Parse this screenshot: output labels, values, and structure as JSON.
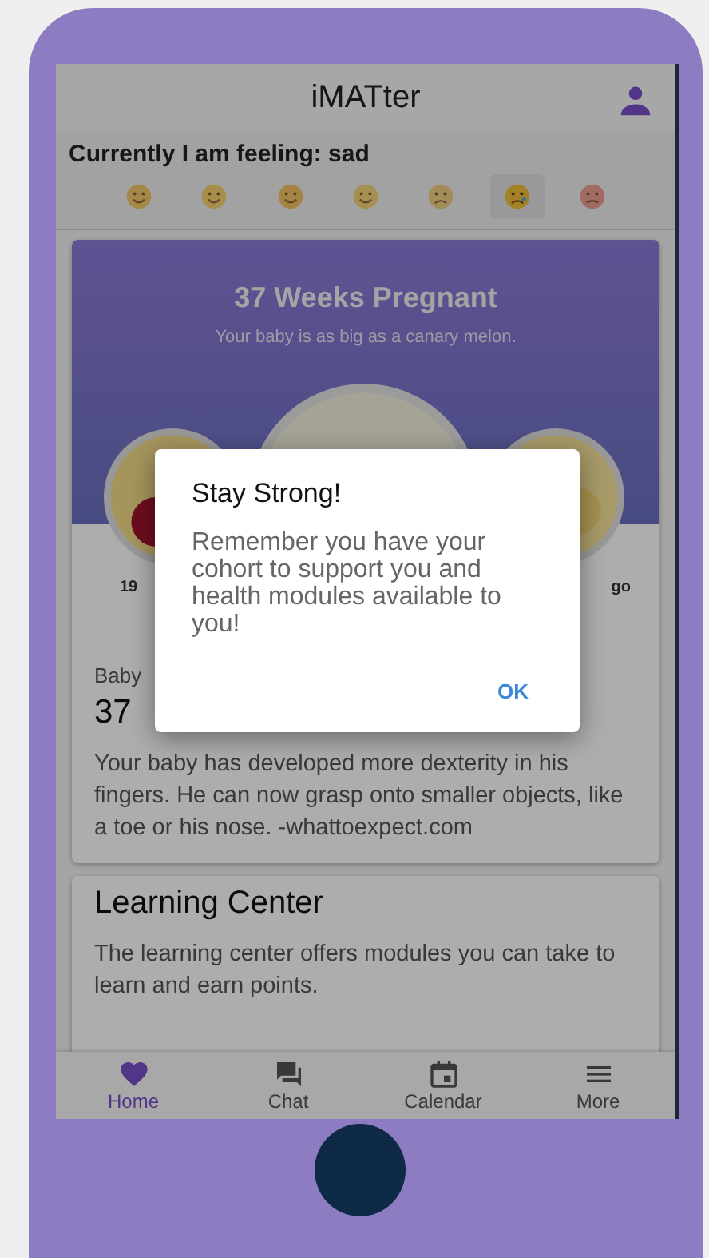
{
  "app_bar": {
    "title": "iMATter"
  },
  "mood_bar": {
    "label": "Currently I am feeling: sad",
    "moods": [
      {
        "kind": "hug",
        "selected": false
      },
      {
        "kind": "happy",
        "selected": false
      },
      {
        "kind": "love",
        "selected": false
      },
      {
        "kind": "neutral",
        "selected": false
      },
      {
        "kind": "tired",
        "selected": false
      },
      {
        "kind": "sad",
        "selected": true
      },
      {
        "kind": "angry",
        "selected": false
      }
    ]
  },
  "pregnancy_card": {
    "title": "37 Weeks Pregnant",
    "subtitle": "Your baby is as big as a canary melon.",
    "left_caption": "19",
    "right_caption": "go",
    "eyebrow": "Baby",
    "heading": "37",
    "body": "Your baby has developed more dexterity in his fingers. He can now grasp onto smaller objects, like a toe or his nose. -whattoexpect.com"
  },
  "learning_card": {
    "title": "Learning Center",
    "body": "The learning center offers modules you can take to learn and earn points."
  },
  "nav": [
    {
      "kind": "home",
      "label": "Home",
      "selected": true
    },
    {
      "kind": "chat",
      "label": "Chat",
      "selected": false
    },
    {
      "kind": "calendar",
      "label": "Calendar",
      "selected": false
    },
    {
      "kind": "more",
      "label": "More",
      "selected": false
    }
  ],
  "dialog": {
    "title": "Stay Strong!",
    "message": "Remember you have your cohort to support you and health modules available to you!",
    "button": "OK"
  }
}
